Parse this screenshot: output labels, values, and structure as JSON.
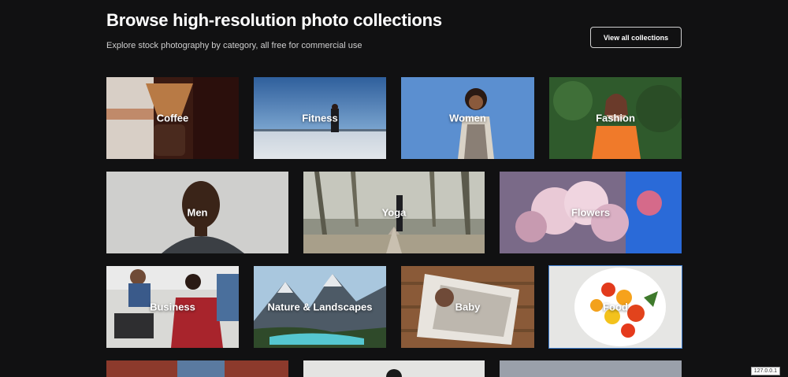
{
  "header": {
    "title": "Browse high-resolution photo collections",
    "subtitle": "Explore stock photography by category, all free for commercial use",
    "view_all_label": "View all collections"
  },
  "collections": {
    "coffee": "Coffee",
    "fitness": "Fitness",
    "women": "Women",
    "fashion": "Fashion",
    "men": "Men",
    "yoga": "Yoga",
    "flowers": "Flowers",
    "business": "Business",
    "nature": "Nature & Landscapes",
    "baby": "Baby",
    "food": "Food"
  },
  "status_badge": "127.0.0.1",
  "colors": {
    "background": "#111112",
    "text": "#ffffff",
    "selected_outline": "#3f7fd0"
  }
}
